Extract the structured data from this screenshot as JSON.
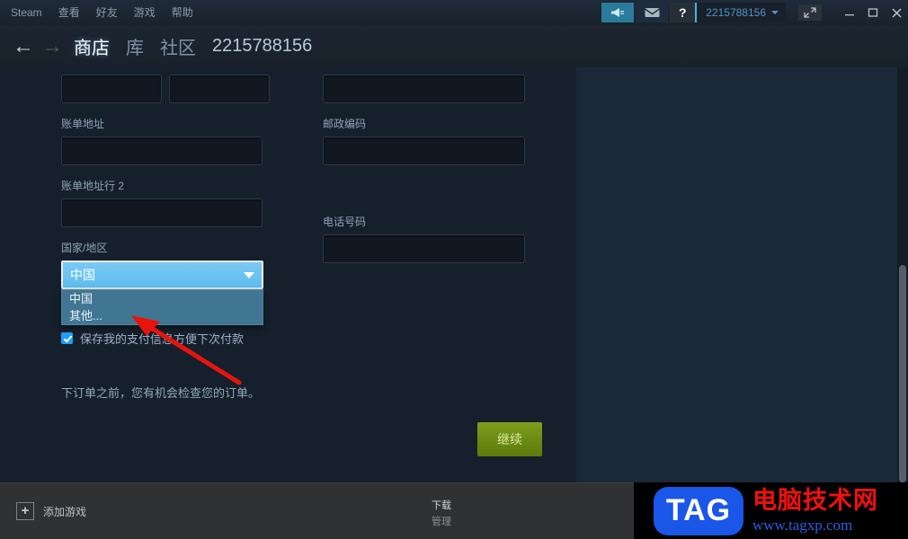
{
  "titlebar": {
    "menu": [
      {
        "label": "Steam"
      },
      {
        "label": "查看"
      },
      {
        "label": "好友"
      },
      {
        "label": "游戏"
      },
      {
        "label": "帮助"
      }
    ],
    "broadcast_icon": "megaphone-icon",
    "mail_icon": "envelope-icon",
    "help_label": "?",
    "account_name": "2215788156",
    "fullscreen_icon": "expand-diagonal-icon",
    "minimize_label": "_",
    "maximize_label": "□",
    "close_label": "✕"
  },
  "navbar": {
    "back_arrow": "←",
    "forward_arrow": "→",
    "links": [
      {
        "label": "商店",
        "active": true
      },
      {
        "label": "库",
        "active": false
      },
      {
        "label": "社区",
        "active": false
      },
      {
        "label": "2215788156",
        "active": false
      }
    ]
  },
  "form": {
    "first_name": {
      "label": "",
      "value": "",
      "placeholder": ""
    },
    "last_name": {
      "label": "",
      "value": "",
      "placeholder": ""
    },
    "city": {
      "label": "",
      "value": "",
      "placeholder": ""
    },
    "billing_address": {
      "label": "账单地址",
      "value": "",
      "placeholder": ""
    },
    "postal_code": {
      "label": "邮政编码",
      "value": "",
      "placeholder": ""
    },
    "billing_address_2": {
      "label": "账单地址行 2",
      "value": "",
      "placeholder": ""
    },
    "country": {
      "label": "国家/地区",
      "selected": "中国",
      "options": [
        "中国",
        "其他..."
      ],
      "expanded": true
    },
    "phone": {
      "label": "电话号码",
      "value": "",
      "placeholder": ""
    },
    "save_payment": {
      "label": "保存我的支付信息方便下次付款",
      "checked": true
    },
    "order_note": "下订单之前，您有机会检查您的订单。",
    "continue_label": "继续"
  },
  "bottombar": {
    "add_game_label": "添加游戏",
    "add_game_icon": "plus-icon",
    "downloads_title": "下载",
    "downloads_sub": "管理"
  },
  "watermark": {
    "logo_text": "TAG",
    "site_name": "电脑技术网",
    "url": "www.tagxp.com"
  },
  "colors": {
    "page_bg": "#1b2838",
    "panel_bg": "#16202c",
    "accent_blue": "#4f94c4",
    "select_highlight": "#5fbdee",
    "dropdown_bg": "#417693",
    "continue_green": "#7d9e1d",
    "checkbox_blue": "#1a9fff",
    "annotation_red": "#e8130d",
    "broadcast_teal": "#2b7b9c"
  }
}
